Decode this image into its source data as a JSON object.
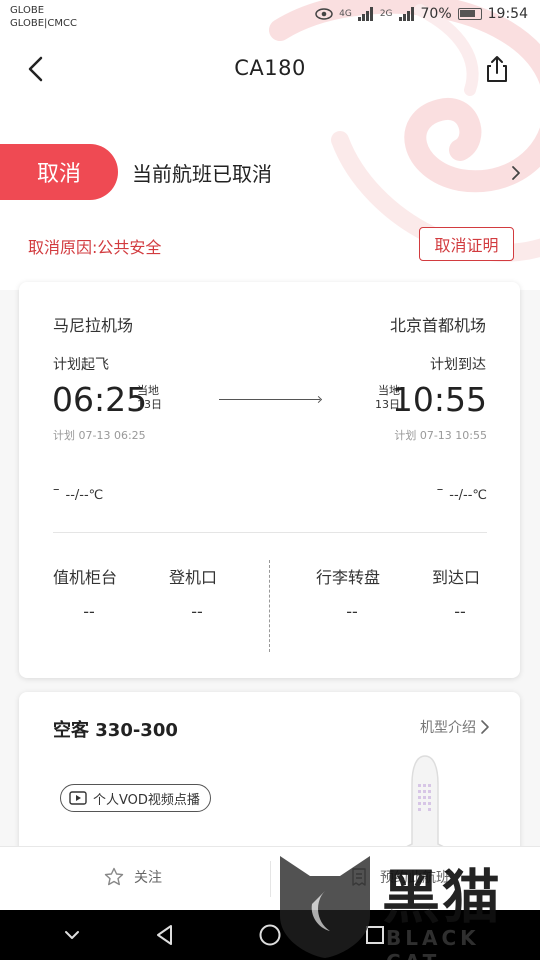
{
  "status_bar": {
    "carrier_line1": "GLOBE",
    "carrier_line2": "GLOBE|CMCC",
    "signal1": "4G",
    "signal2": "2G",
    "battery": "70%",
    "time": "19:54"
  },
  "header": {
    "title": "CA180"
  },
  "cancel_banner": {
    "pill_label": "取消",
    "status_text": "当前航班已取消"
  },
  "reason": {
    "text": "取消原因:公共安全",
    "proof_button": "取消证明"
  },
  "flight": {
    "departure": {
      "airport": "马尼拉机场",
      "label": "计划起飞",
      "time": "06:25",
      "local_line1": "当地",
      "local_line2": "13日",
      "scheduled": "计划 07-13 06:25",
      "weather_icon": "–",
      "weather": "--/--℃"
    },
    "arrival": {
      "airport": "北京首都机场",
      "label": "计划到达",
      "time": "10:55",
      "local_line1": "当地",
      "local_line2": "13日",
      "scheduled": "计划 07-13 10:55",
      "weather_icon": "–",
      "weather": "--/--℃"
    },
    "info": [
      {
        "label": "值机柜台",
        "value": "--"
      },
      {
        "label": "登机口",
        "value": "--"
      },
      {
        "label": "行李转盘",
        "value": "--"
      },
      {
        "label": "到达口",
        "value": "--"
      }
    ]
  },
  "aircraft": {
    "name": "空客 330-300",
    "link": "机型介绍",
    "vod_label": "个人VOD视频点播"
  },
  "bottom_bar": {
    "follow": "关注",
    "checkin": "预约此航班"
  },
  "watermark": {
    "main": "黑猫",
    "sub": "BLACK CAT"
  },
  "colors": {
    "accent": "#ef4a53",
    "reason_red": "#d23b3f"
  }
}
